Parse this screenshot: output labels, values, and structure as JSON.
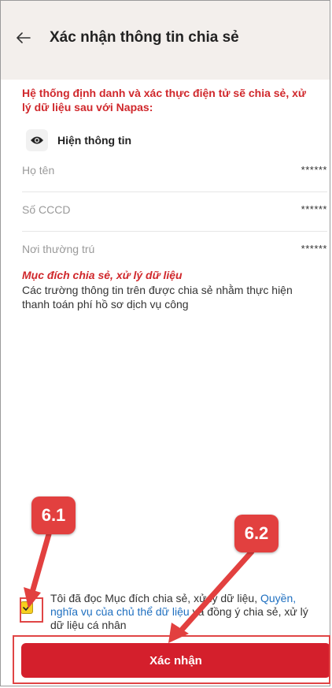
{
  "header": {
    "title": "Xác nhận thông tin chia sẻ",
    "back_icon": "arrow-left-icon"
  },
  "intro": "Hệ thống định danh và xác thực điện tử sẽ chia sẻ, xử lý dữ liệu sau với Napas:",
  "toggle": {
    "label": "Hiện thông tin",
    "icon": "eye-icon"
  },
  "fields": [
    {
      "label": "Họ tên",
      "value": "******"
    },
    {
      "label": "Số CCCD",
      "value": "******"
    },
    {
      "label": "Nơi thường trú",
      "value": "******"
    }
  ],
  "purpose": {
    "title": "Mục đích chia sẻ, xử lý dữ liệu",
    "text": "Các trường thông tin trên được chia sẻ nhằm thực hiện thanh toán phí hồ sơ dịch vụ công"
  },
  "agreement": {
    "checked": true,
    "text_before": "Tôi đã đọc Mục đích chia sẻ, xử lý dữ liệu, ",
    "link_text": "Quyền, nghĩa vụ của chủ thể dữ liệu",
    "text_after": " và đồng ý chia sẻ, xử lý dữ liệu cá nhân"
  },
  "confirm_label": "Xác nhận",
  "annotations": {
    "badge_1": "6.1",
    "badge_2": "6.2",
    "color": "#e2403f"
  },
  "colors": {
    "accent_red": "#d41f2c",
    "link_blue": "#1e6fc0",
    "checkbox_yellow": "#f6cf1e",
    "header_bg": "#f3efec"
  }
}
